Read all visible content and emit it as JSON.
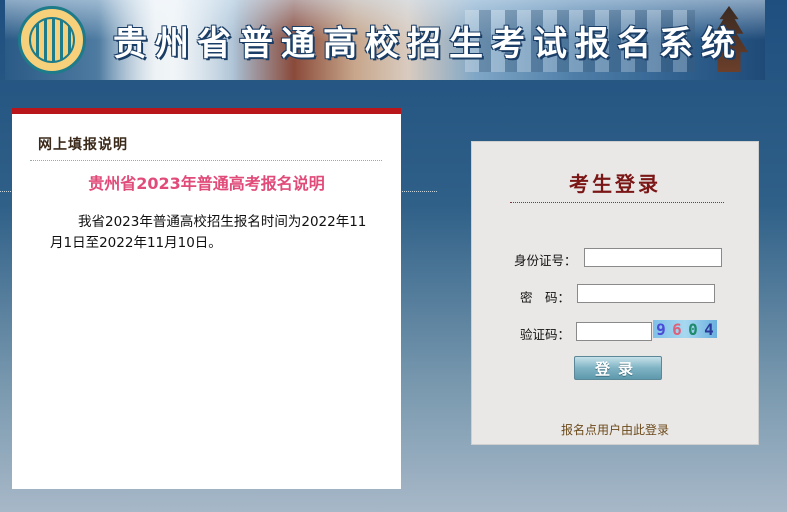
{
  "banner": {
    "title": "贵州省普通高校招生考试报名系统",
    "logo_icon": "provincial-exam-logo"
  },
  "info_panel": {
    "heading": "网上填报说明",
    "subtitle": "贵州省2023年普通高考报名说明",
    "body": "我省2023年普通高校招生报名时间为2022年11月1日至2022年11月10日。"
  },
  "login": {
    "title": "考生登录",
    "id_label": "身份证号：",
    "id_value": "",
    "password_label": "密　码：",
    "password_value": "",
    "captcha_label": "验证码：",
    "captcha_value": "",
    "captcha_digits": [
      "9",
      "6",
      "0",
      "4"
    ],
    "submit_label": "登录",
    "site_link": "报名点用户由此登录"
  },
  "colors": {
    "accent_red": "#b8161a",
    "subtitle_pink": "#e14b7a",
    "login_title": "#7a1616"
  }
}
